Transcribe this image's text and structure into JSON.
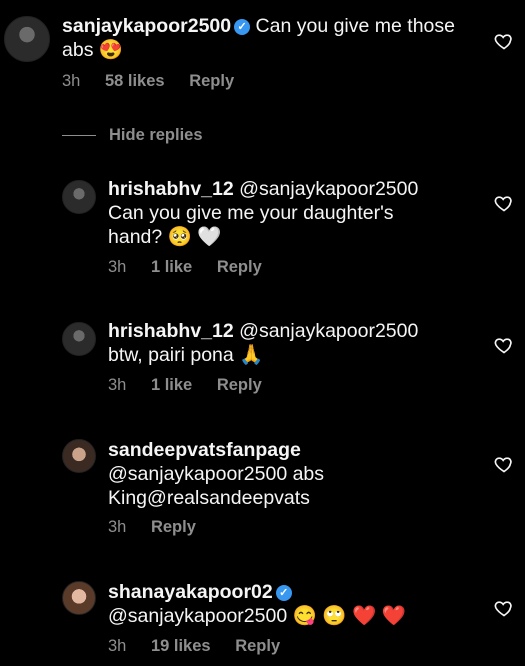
{
  "comments": [
    {
      "username": "sanjaykapoor2500",
      "verified": true,
      "text": "Can you give me those abs 😍",
      "time": "3h",
      "likes": "58 likes",
      "reply": "Reply"
    },
    {
      "username": "hrishabhv_12",
      "mention": "@sanjaykapoor2500",
      "text": "Can you give me your daughter's hand? 🥺 🤍",
      "time": "3h",
      "likes": "1 like",
      "reply": "Reply"
    },
    {
      "username": "hrishabhv_12",
      "mention": "@sanjaykapoor2500",
      "text": "btw, pairi pona 🙏",
      "time": "3h",
      "likes": "1 like",
      "reply": "Reply"
    },
    {
      "username": "sandeepvatsfanpage",
      "text": "@sanjaykapoor2500 abs King@realsandeepvats",
      "time": "3h",
      "reply": "Reply"
    },
    {
      "username": "shanayakapoor02",
      "verified": true,
      "text": "@sanjaykapoor2500 😋 🙄 ❤️ ❤️",
      "time": "3h",
      "likes": "19 likes",
      "reply": "Reply"
    }
  ],
  "hide_replies": "Hide replies",
  "icons": {
    "like": "heart-outline-icon",
    "verified": "verified-badge-icon"
  },
  "colors": {
    "background": "#000000",
    "text": "#f5f5f5",
    "meta": "#8e8e8e",
    "verified": "#3897f0"
  }
}
